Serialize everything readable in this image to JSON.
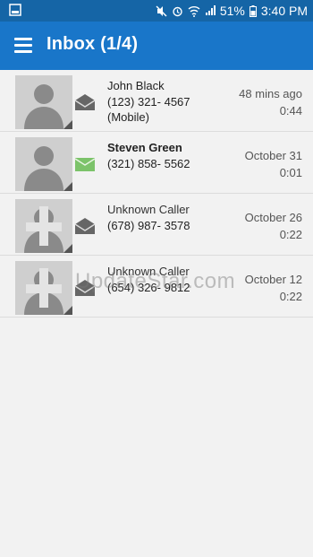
{
  "status_bar": {
    "battery": "51%",
    "time": "3:40 PM"
  },
  "app_bar": {
    "title": "Inbox (1/4)"
  },
  "messages": [
    {
      "name": "John Black",
      "phone": "(123) 321- 4567",
      "phone_type": "(Mobile)",
      "when": "48 mins ago",
      "duration": "0:44",
      "read": true
    },
    {
      "name": "Steven Green",
      "phone": "(321) 858- 5562",
      "phone_type": "",
      "when": "October 31",
      "duration": "0:01",
      "read": false
    },
    {
      "name": "Unknown Caller",
      "phone": "(678) 987- 3578",
      "phone_type": "",
      "when": "October 26",
      "duration": "0:22",
      "read": true
    },
    {
      "name": "Unknown Caller",
      "phone": "(654) 326- 9812",
      "phone_type": "",
      "when": "October 12",
      "duration": "0:22",
      "read": true
    }
  ],
  "watermark": "UpdateStar.com",
  "colors": {
    "status_bar": "#1565a6",
    "app_bar": "#1976c9",
    "unread_icon": "#7cc36a",
    "read_icon": "#666666"
  }
}
